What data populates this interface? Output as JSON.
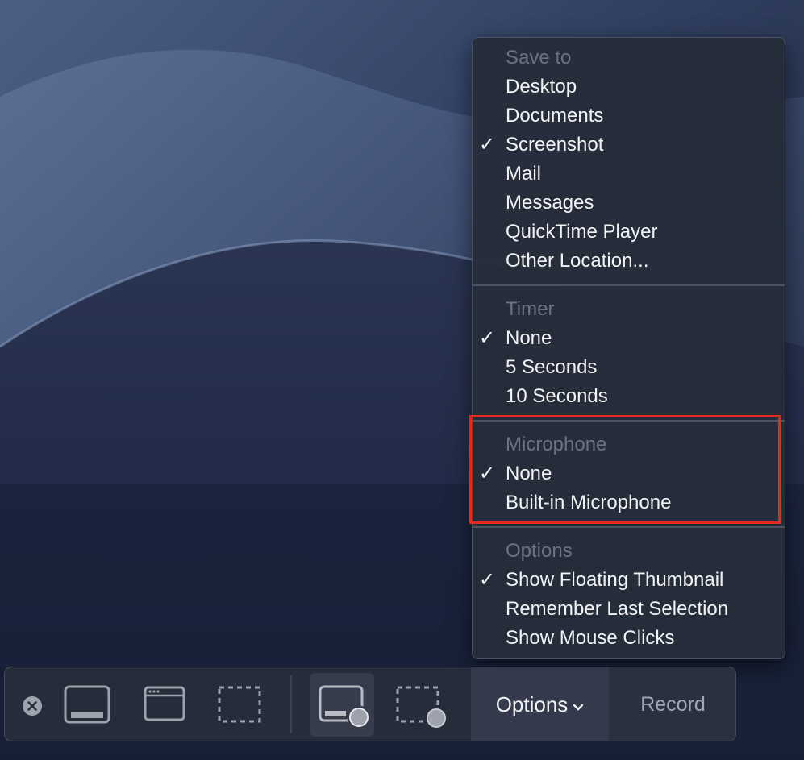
{
  "menu": {
    "sections": [
      {
        "header": "Save to",
        "items": [
          {
            "label": "Desktop",
            "checked": false
          },
          {
            "label": "Documents",
            "checked": false
          },
          {
            "label": "Screenshot",
            "checked": true
          },
          {
            "label": "Mail",
            "checked": false
          },
          {
            "label": "Messages",
            "checked": false
          },
          {
            "label": "QuickTime Player",
            "checked": false
          },
          {
            "label": "Other Location...",
            "checked": false
          }
        ]
      },
      {
        "header": "Timer",
        "items": [
          {
            "label": "None",
            "checked": true
          },
          {
            "label": "5 Seconds",
            "checked": false
          },
          {
            "label": "10 Seconds",
            "checked": false
          }
        ]
      },
      {
        "header": "Microphone",
        "items": [
          {
            "label": "None",
            "checked": true
          },
          {
            "label": "Built-in Microphone",
            "checked": false
          }
        ]
      },
      {
        "header": "Options",
        "items": [
          {
            "label": "Show Floating Thumbnail",
            "checked": true
          },
          {
            "label": "Remember Last Selection",
            "checked": false
          },
          {
            "label": "Show Mouse Clicks",
            "checked": false
          }
        ]
      }
    ],
    "check_glyph": "✓"
  },
  "toolbar": {
    "close_icon": "close-icon",
    "options_label": "Options",
    "options_chevron": "⌄",
    "record_label": "Record"
  },
  "colors": {
    "highlight_border": "#e12a1b",
    "menu_bg": "#262c3a",
    "header_text": "#6d7282"
  }
}
